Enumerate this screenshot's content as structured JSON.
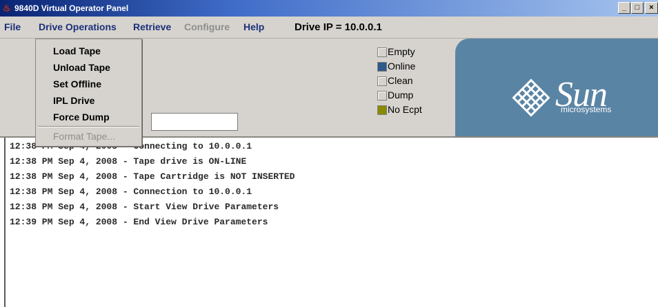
{
  "window": {
    "title": "9840D Virtual Operator Panel",
    "controls": [
      "_",
      "□",
      "×"
    ]
  },
  "menubar": {
    "items": [
      {
        "label": "File",
        "enabled": true
      },
      {
        "label": "Drive Operations",
        "enabled": true
      },
      {
        "label": "Retrieve",
        "enabled": true
      },
      {
        "label": "Configure",
        "enabled": false
      },
      {
        "label": "Help",
        "enabled": true
      }
    ],
    "drive_ip": "Drive IP = 10.0.0.1"
  },
  "drive_operations_menu": {
    "items": [
      {
        "label": "Load Tape",
        "enabled": true
      },
      {
        "label": "Unload Tape",
        "enabled": true
      },
      {
        "label": "Set Offline",
        "enabled": true
      },
      {
        "label": "IPL Drive",
        "enabled": true
      },
      {
        "label": "Force Dump",
        "enabled": true
      },
      {
        "label": "Format Tape...",
        "enabled": false
      }
    ]
  },
  "status_field": {
    "value": ""
  },
  "indicators": [
    {
      "label": "Empty",
      "color": "#d6d3ce"
    },
    {
      "label": "Online",
      "color": "#2f5a8a"
    },
    {
      "label": "Clean",
      "color": "#d6d3ce"
    },
    {
      "label": "Dump",
      "color": "#d6d3ce"
    },
    {
      "label": "No Ecpt",
      "color": "#8a8a00"
    }
  ],
  "logo": {
    "wordmark": "Sun",
    "subtitle": "microsystems",
    "background": "#5a84a4"
  },
  "log": [
    "12:38 PM Sep 4, 2008 - Connecting to 10.0.0.1",
    "12:38 PM Sep 4, 2008 - Tape drive is ON-LINE",
    "12:38 PM Sep 4, 2008 - Tape Cartridge is NOT INSERTED",
    "12:38 PM Sep 4, 2008 - Connection to 10.0.0.1",
    "12:38 PM Sep 4, 2008 - Start View Drive Parameters",
    "12:39 PM Sep 4, 2008 - End View Drive Parameters"
  ]
}
